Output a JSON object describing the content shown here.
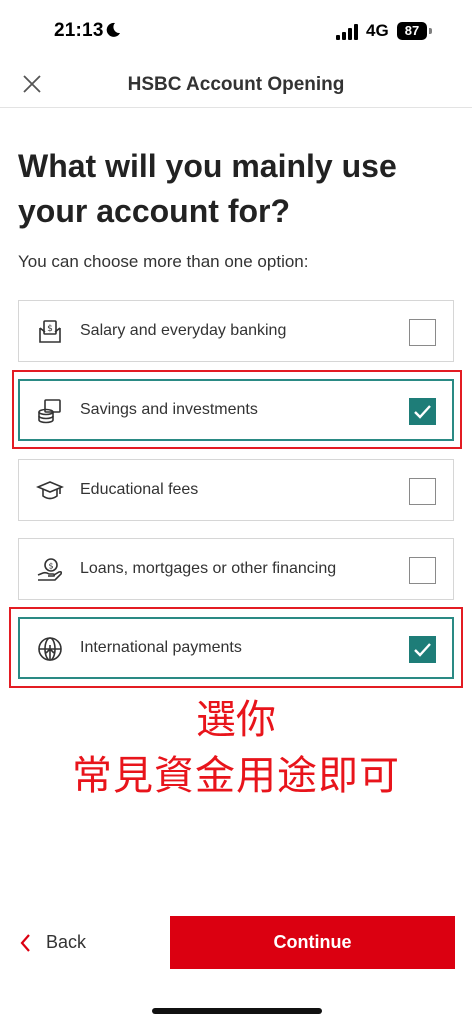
{
  "status_bar": {
    "time": "21:13",
    "network": "4G",
    "battery": "87"
  },
  "nav": {
    "title": "HSBC Account Opening"
  },
  "page": {
    "heading": "What will you mainly use your account for?",
    "subtitle": "You can choose more than one option:"
  },
  "options": [
    {
      "label": "Salary and everyday banking",
      "icon": "salary-icon",
      "checked": false
    },
    {
      "label": "Savings and investments",
      "icon": "coins-icon",
      "checked": true
    },
    {
      "label": "Educational fees",
      "icon": "graduation-cap-icon",
      "checked": false
    },
    {
      "label": "Loans, mortgages or other financing",
      "icon": "loan-hand-icon",
      "checked": false
    },
    {
      "label": "International payments",
      "icon": "globe-icon",
      "checked": true
    }
  ],
  "annotation": {
    "line1": "選你",
    "line2": "常見資金用途即可"
  },
  "footer": {
    "back_label": "Back",
    "continue_label": "Continue"
  },
  "colors": {
    "brand_red": "#db0011",
    "check_teal": "#1e7d78",
    "annotation_red": "#e8141b"
  }
}
